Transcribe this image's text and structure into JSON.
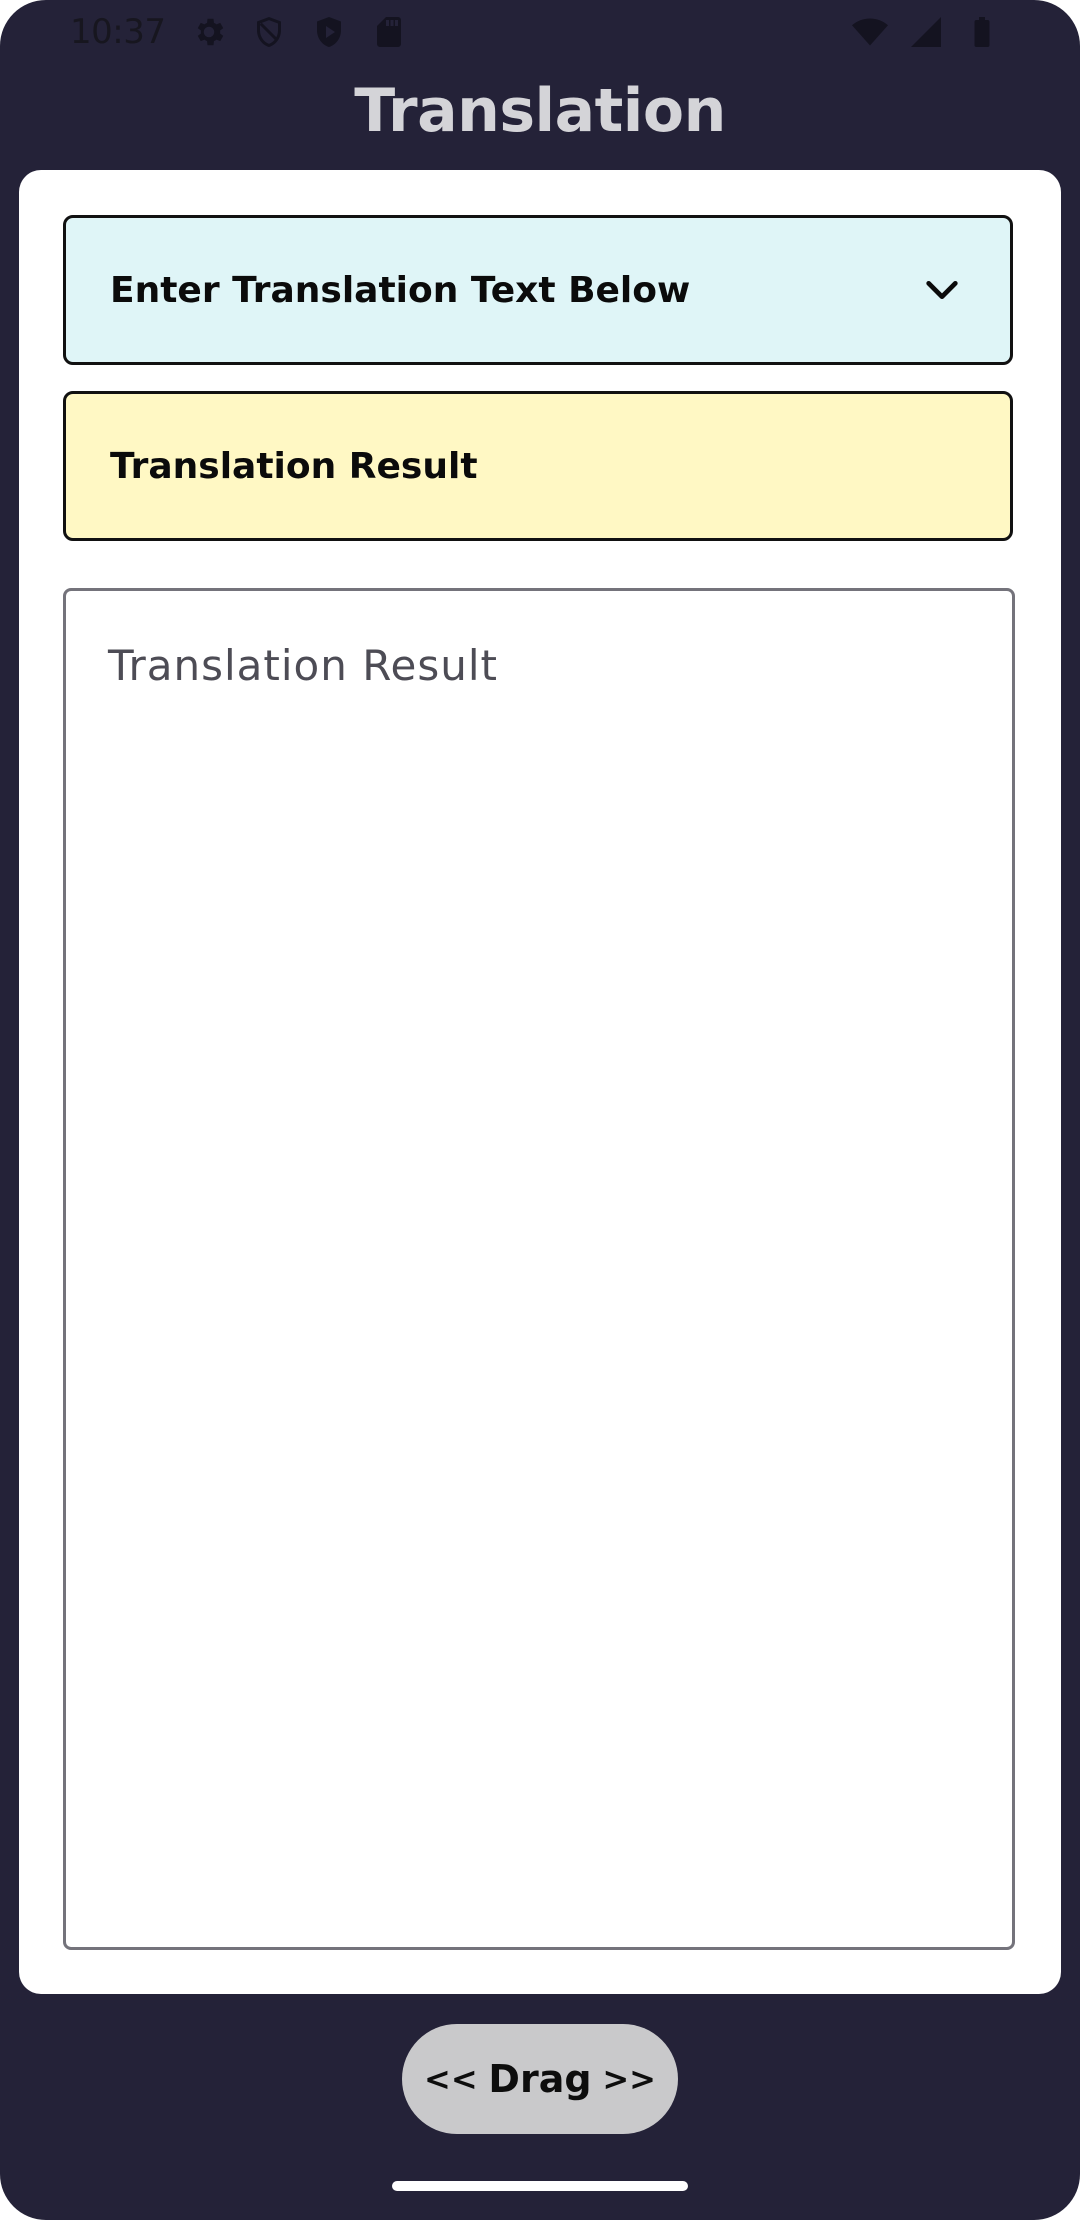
{
  "status_bar": {
    "time": "10:37",
    "left_icons": [
      "settings-icon",
      "shield-icon",
      "play-protect-icon",
      "sd-card-icon"
    ],
    "right_icons": [
      "wifi-icon",
      "cell-signal-icon",
      "battery-icon"
    ]
  },
  "header": {
    "title": "Translation"
  },
  "input_panel": {
    "label": "Enter Translation Text Below",
    "icon": "chevron-down-icon",
    "background": "#dff5f7"
  },
  "result_panel": {
    "label": "Translation Result",
    "background": "#fff8c4"
  },
  "result_field": {
    "placeholder": "Translation Result",
    "value": ""
  },
  "drag_handle": {
    "left": "<<",
    "label": "Drag",
    "right": ">>"
  },
  "colors": {
    "background": "#242238",
    "title": "#d4d4d8",
    "card": "#ffffff",
    "pill": "#c9c9cb"
  }
}
